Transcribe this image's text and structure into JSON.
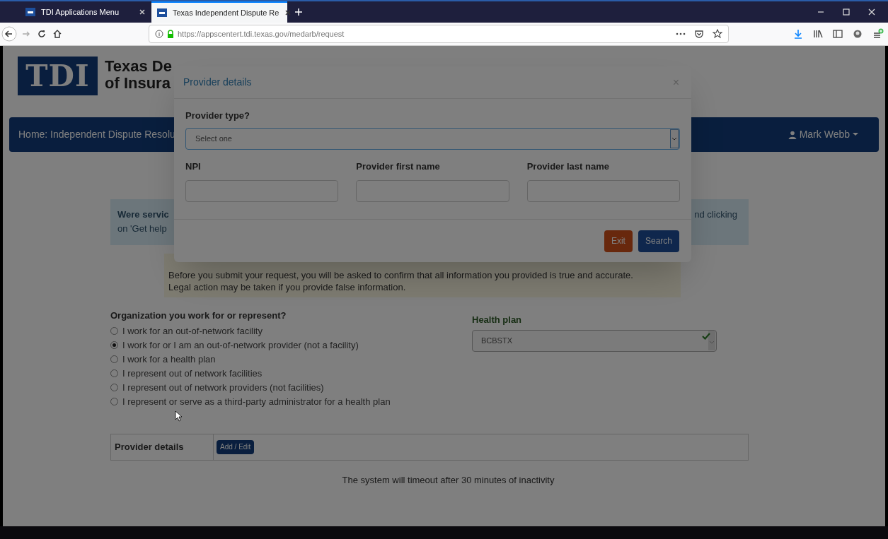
{
  "browser": {
    "tabs": [
      {
        "title": "TDI Applications Menu",
        "selected": false
      },
      {
        "title": "Texas Independent Dispute Re",
        "selected": true
      }
    ],
    "url": "https://appscentert.tdi.texas.gov/medarb/request"
  },
  "page": {
    "logo": {
      "mark": "TDI",
      "line_1": "Texas De",
      "line_2": "of Insura"
    },
    "nav": {
      "home": "Home: Independent Dispute Resolu",
      "user": "Mark Webb"
    },
    "info": {
      "lead": "Were servic",
      "line_2": "on 'Get help",
      "tail": "nd clicking"
    },
    "notice": [
      "Before you submit your request, you will be asked to confirm that all information you provided is true and accurate.",
      "Legal action may be taken if you provide false information."
    ],
    "organization": {
      "question": "Organization you work for or represent?",
      "options": [
        {
          "label": "I work for an out-of-network facility",
          "selected": false
        },
        {
          "label": "I work for or I am an out-of-network provider (not a facility)",
          "selected": true
        },
        {
          "label": "I work for a health plan",
          "selected": false
        },
        {
          "label": "I represent out of network facilities",
          "selected": false
        },
        {
          "label": "I represent out of network providers (not facilities)",
          "selected": false
        },
        {
          "label": "I represent or serve as a third-party administrator for a health plan",
          "selected": false
        }
      ]
    },
    "health_plan": {
      "label": "Health plan",
      "value": "BCBSTX",
      "valid": true
    },
    "provider_details": {
      "label": "Provider details",
      "button": "Add / Edit"
    },
    "timeout": "The system will timeout after 30 minutes of inactivity"
  },
  "modal": {
    "title": "Provider details",
    "close": "×",
    "provider_type": {
      "label": "Provider type?",
      "placeholder": "Select one"
    },
    "fields": [
      {
        "label": "NPI"
      },
      {
        "label": "Provider first name"
      },
      {
        "label": "Provider last name"
      }
    ],
    "buttons": [
      {
        "kind": "danger",
        "label": "Exit"
      },
      {
        "kind": "primary",
        "label": "Search"
      }
    ]
  }
}
